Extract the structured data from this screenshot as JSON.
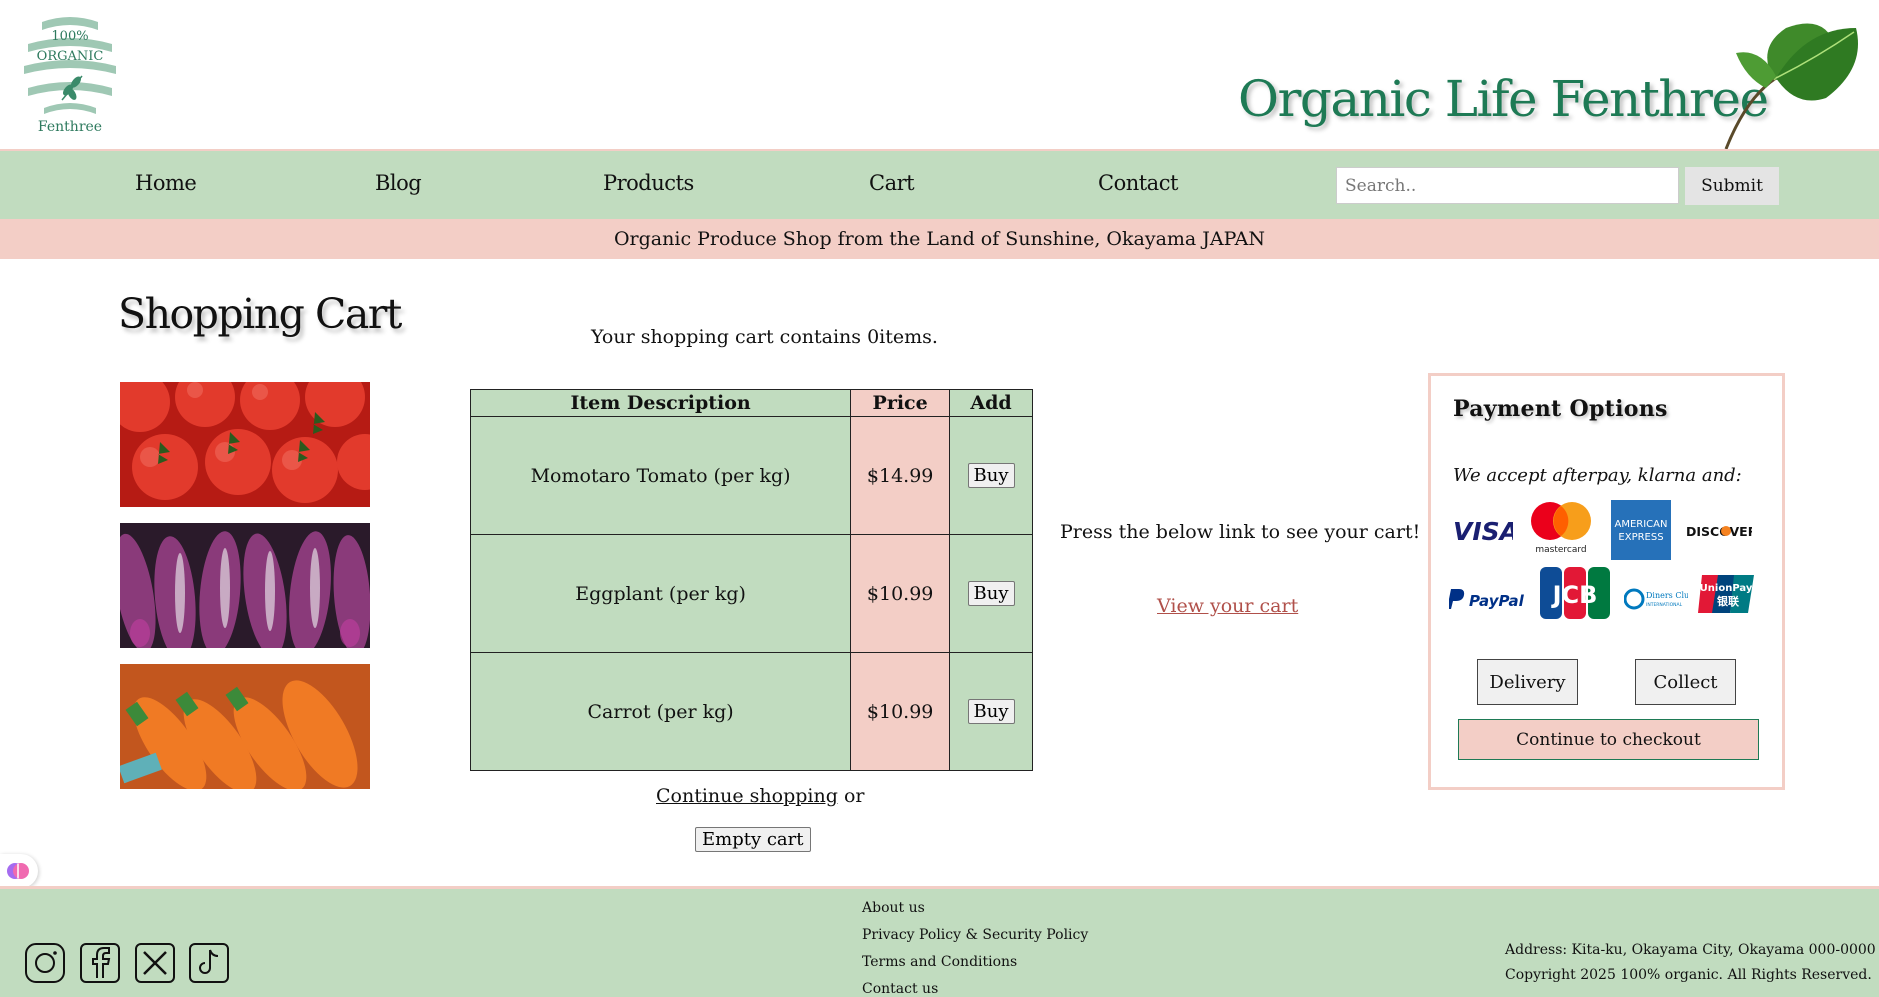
{
  "header": {
    "logo": {
      "top_text": "100%",
      "mid_text": "ORGANIC",
      "bottom_text": "Fenthree"
    },
    "site_title": "Organic Life Fenthree"
  },
  "nav": {
    "items": [
      "Home",
      "Blog",
      "Products",
      "Cart",
      "Contact"
    ],
    "search_placeholder": "Search..",
    "submit_label": "Submit"
  },
  "banner": {
    "text": "Organic Produce Shop from the Land of Sunshine, Okayama JAPAN"
  },
  "main": {
    "title": "Shopping Cart",
    "cart_count_text": "Your shopping cart contains 0items.",
    "table": {
      "headers": [
        "Item Description",
        "Price",
        "Add"
      ],
      "rows": [
        {
          "description": "Momotaro Tomato (per kg)",
          "price": "$14.99",
          "action": "Buy"
        },
        {
          "description": "Eggplant (per kg)",
          "price": "$10.99",
          "action": "Buy"
        },
        {
          "description": "Carrot (per kg)",
          "price": "$10.99",
          "action": "Buy"
        }
      ]
    },
    "continue_link": "Continue shopping",
    "continue_suffix": " or",
    "empty_cart_label": "Empty cart",
    "press_text": "Press the below link to see your cart!",
    "view_cart_link": "View your cart"
  },
  "payment": {
    "title": "Payment Options",
    "accept_text": "We accept afterpay, klarna and:",
    "cards": {
      "visa": "VISA",
      "mastercard": "mastercard",
      "amex_line1": "AMERICAN",
      "amex_line2": "EXPRESS",
      "discover": "DISCOVER",
      "paypal": "PayPal",
      "jcb": "JCB",
      "diners_line1": "Diners Club",
      "diners_line2": "INTERNATIONAL",
      "unionpay_line1": "UnionPay",
      "unionpay_line2": "银联"
    },
    "delivery_label": "Delivery",
    "collect_label": "Collect",
    "checkout_label": "Continue to checkout"
  },
  "footer": {
    "links": [
      "About us",
      "Privacy Policy & Security Policy",
      "Terms and Conditions",
      "Contact us"
    ],
    "address": "Address: Kita-ku, Okayama City, Okayama 000-0000",
    "copyright": "Copyright 2025 100% organic. All Rights Reserved."
  },
  "colors": {
    "green": "#c1dcbf",
    "pink": "#f3cec6",
    "brand_green": "#1e7a55",
    "link_red": "#b0504a"
  }
}
